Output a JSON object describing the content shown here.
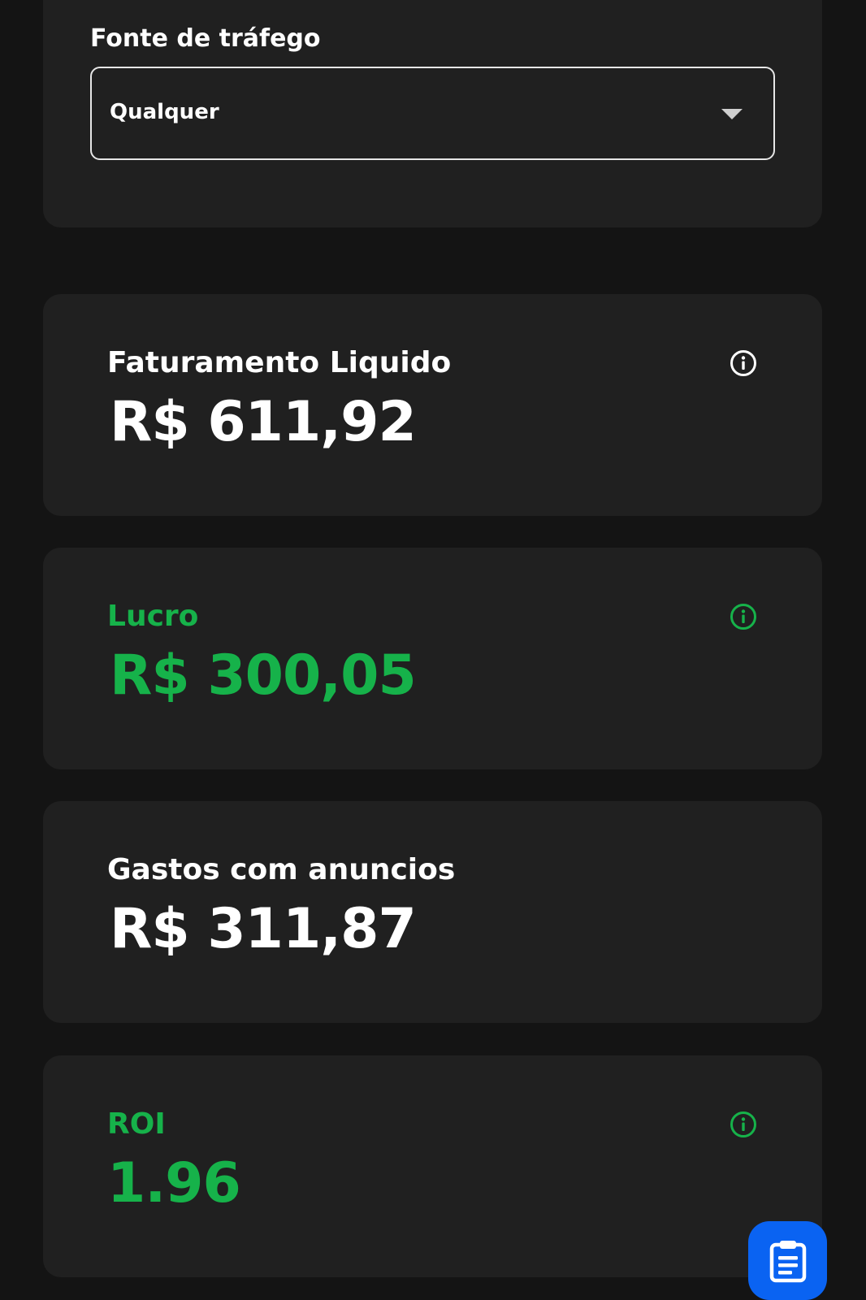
{
  "filter": {
    "label": "Fonte de tráfego",
    "selected_value": "Qualquer",
    "dropdown_icon": "chevron-down-icon"
  },
  "metrics": [
    {
      "title": "Faturamento Liquido",
      "value": "R$ 611,92",
      "has_info": true
    },
    {
      "title": "Lucro",
      "value": "R$ 300,05",
      "has_info": true,
      "color": "#16b24a"
    },
    {
      "title": "Gastos com anuncios",
      "value": "R$ 311,87",
      "has_info": false
    },
    {
      "title": "ROI",
      "value": "1.96",
      "has_info": true,
      "color": "#16b24a"
    }
  ],
  "fab": {
    "icon": "clipboard-list-icon",
    "color": "#0a63f2"
  },
  "colors": {
    "background": "#141414",
    "card": "#202020",
    "accent_green": "#16b24a",
    "accent_blue": "#0a63f2"
  }
}
